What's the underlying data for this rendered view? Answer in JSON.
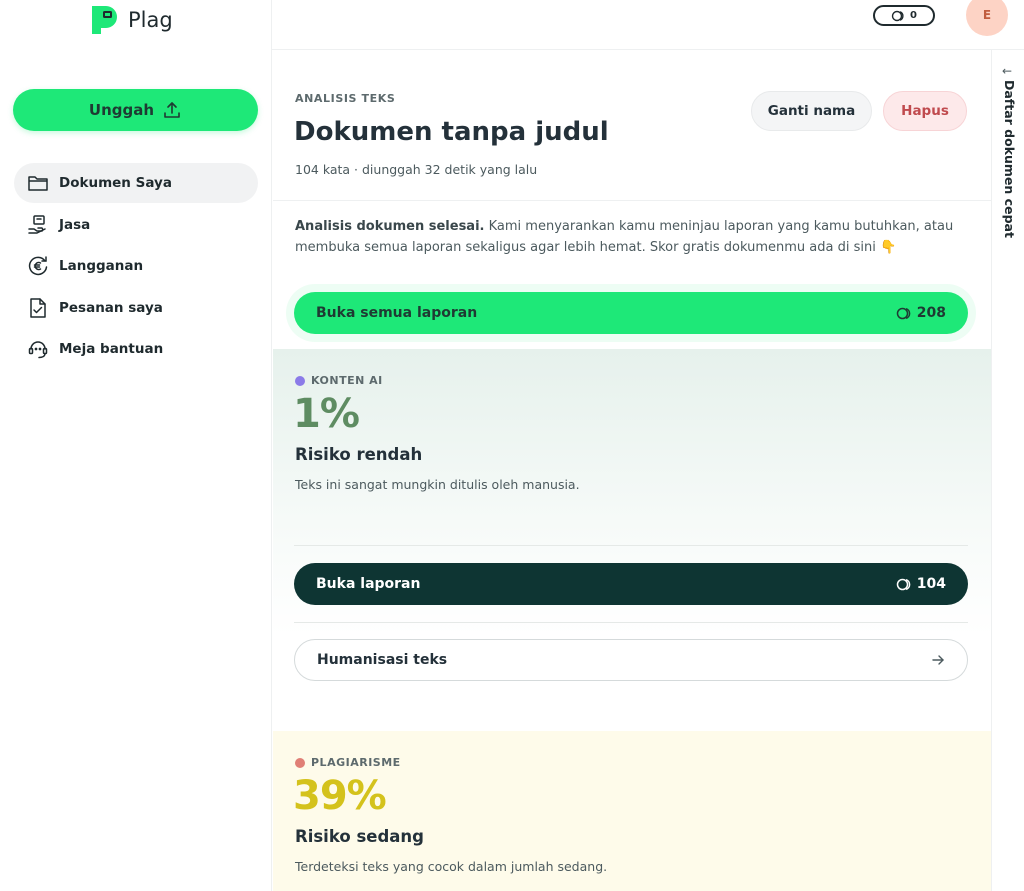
{
  "app": {
    "name": "Plag"
  },
  "sidebar": {
    "upload_label": "Unggah",
    "items": [
      {
        "label": "Dokumen Saya",
        "icon": "folder-icon",
        "active": true
      },
      {
        "label": "Jasa",
        "icon": "service-hand-icon",
        "active": false
      },
      {
        "label": "Langganan",
        "icon": "euro-cycle-icon",
        "active": false
      },
      {
        "label": "Pesanan saya",
        "icon": "document-check-icon",
        "active": false
      },
      {
        "label": "Meja bantuan",
        "icon": "support-headset-icon",
        "active": false
      }
    ]
  },
  "topbar": {
    "credits": "0",
    "avatar_initial": "E"
  },
  "rail": {
    "label": "Daftar dokumen cepat"
  },
  "document": {
    "eyebrow": "ANALISIS TEKS",
    "title": "Dokumen tanpa judul",
    "meta": "104 kata · diunggah 32 detik yang lalu",
    "rename_label": "Ganti nama",
    "delete_label": "Hapus"
  },
  "summary": {
    "bold": "Analisis dokumen selesai.",
    "text": " Kami menyarankan kamu meninjau laporan yang kamu butuhkan, atau membuka semua laporan sekaligus agar lebih hemat. Skor gratis dokumenmu ada di sini 👇"
  },
  "open_all": {
    "label": "Buka semua laporan",
    "cost": "208"
  },
  "ai": {
    "tag": "KONTEN AI",
    "percent": "1%",
    "risk": "Risiko rendah",
    "description": "Teks ini sangat mungkin ditulis oleh manusia.",
    "open_label": "Buka laporan",
    "open_cost": "104",
    "humanize_label": "Humanisasi teks",
    "colors": {
      "dot": "#8b7be8",
      "percent": "#5e8c62"
    }
  },
  "plagiarism": {
    "tag": "PLAGIARISME",
    "percent": "39%",
    "risk": "Risiko sedang",
    "description": "Terdeteksi teks yang cocok dalam jumlah sedang.",
    "colors": {
      "dot": "#e07f76",
      "percent": "#d4c21c"
    }
  },
  "colors": {
    "accent": "#1ee878",
    "dark_button": "#0e3533"
  }
}
